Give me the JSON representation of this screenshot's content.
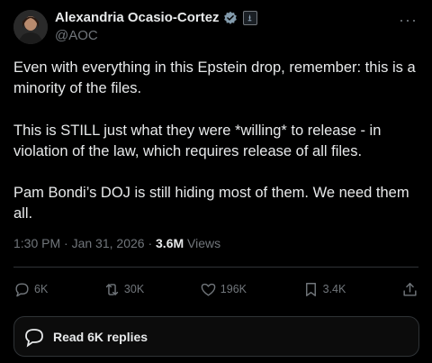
{
  "author": {
    "name": "Alexandria Ocasio-Cortez",
    "handle": "@AOC",
    "verified_color": "#829aab"
  },
  "post": {
    "paragraphs": [
      "Even with everything in this Epstein drop, remember: this is a minority of the files.",
      "This is STILL just what they were *willing* to release - in violation of the law, which requires release of all files.",
      "Pam Bondi’s DOJ is still hiding most of them. We need them all."
    ],
    "time": "1:30 PM",
    "date": "Jan 31, 2026",
    "separator": "·",
    "views_count": "3.6M",
    "views_label": "Views"
  },
  "actions": {
    "replies": "6K",
    "reposts": "30K",
    "likes": "196K",
    "bookmarks": "3.4K"
  },
  "read_replies_label": "Read 6K replies",
  "icons": [
    "verified-icon",
    "government-affiliation-icon",
    "more-icon",
    "reply-icon",
    "repost-icon",
    "like-icon",
    "bookmark-icon",
    "share-icon",
    "replies-bubble-icon"
  ]
}
